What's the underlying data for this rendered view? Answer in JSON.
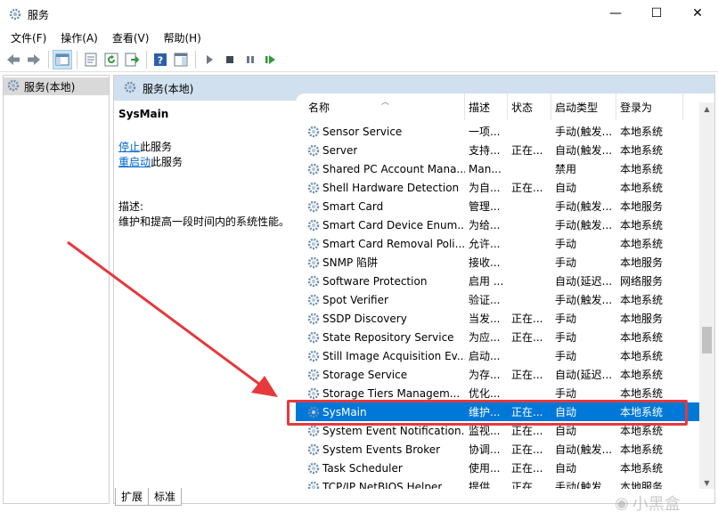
{
  "window": {
    "title": "服务",
    "minimize_glyph": "—",
    "maximize_glyph": "☐",
    "close_glyph": "✕"
  },
  "menu": [
    "文件(F)",
    "操作(A)",
    "查看(V)",
    "帮助(H)"
  ],
  "tree": {
    "root_label": "服务(本地)"
  },
  "panel": {
    "header": "服务(本地)",
    "service_name": "SysMain",
    "stop_link": "停止",
    "stop_suffix": "此服务",
    "restart_link": "重启动",
    "restart_suffix": "此服务",
    "description_label": "描述:",
    "description_text": "维护和提高一段时间内的系统性能。"
  },
  "table": {
    "columns": [
      "名称",
      "描述",
      "状态",
      "启动类型",
      "登录为"
    ],
    "rows": [
      [
        "Sensor Service",
        "一项...",
        "",
        "手动(触发...",
        "本地系统"
      ],
      [
        "Server",
        "支持...",
        "正在...",
        "自动(触发...",
        "本地系统"
      ],
      [
        "Shared PC Account Mana...",
        "Man...",
        "",
        "禁用",
        "本地系统"
      ],
      [
        "Shell Hardware Detection",
        "为自...",
        "正在...",
        "自动",
        "本地系统"
      ],
      [
        "Smart Card",
        "管理...",
        "",
        "手动(触发...",
        "本地服务"
      ],
      [
        "Smart Card Device Enum...",
        "为给...",
        "",
        "手动(触发...",
        "本地系统"
      ],
      [
        "Smart Card Removal Poli...",
        "允许...",
        "",
        "手动",
        "本地系统"
      ],
      [
        "SNMP 陷阱",
        "接收...",
        "",
        "手动",
        "本地服务"
      ],
      [
        "Software Protection",
        "启用 ...",
        "",
        "自动(延迟...",
        "网络服务"
      ],
      [
        "Spot Verifier",
        "验证...",
        "",
        "手动(触发...",
        "本地系统"
      ],
      [
        "SSDP Discovery",
        "当发...",
        "正在...",
        "手动",
        "本地服务"
      ],
      [
        "State Repository Service",
        "为应...",
        "正在...",
        "手动",
        "本地系统"
      ],
      [
        "Still Image Acquisition Ev...",
        "启动...",
        "",
        "手动",
        "本地系统"
      ],
      [
        "Storage Service",
        "为存...",
        "正在...",
        "自动(延迟...",
        "本地系统"
      ],
      [
        "Storage Tiers Managem...",
        "优化...",
        "",
        "手动",
        "本地系统"
      ],
      [
        "SysMain",
        "维护...",
        "正在...",
        "自动",
        "本地系统"
      ],
      [
        "System Event Notification...",
        "监视...",
        "正在...",
        "自动",
        "本地系统"
      ],
      [
        "System Events Broker",
        "协调...",
        "正在...",
        "自动(触发...",
        "本地系统"
      ],
      [
        "Task Scheduler",
        "使用...",
        "正在...",
        "自动",
        "本地系统"
      ],
      [
        "TCP/IP NetBIOS Helper",
        "提供...",
        "正在...",
        "手动(触发...",
        "本地服务"
      ]
    ],
    "selected_index": 15
  },
  "tabs": [
    "扩展",
    "标准"
  ],
  "watermark": "小黑盒",
  "colors": {
    "selection": "#0078d7",
    "highlight": "#e5393d",
    "header_bg": "#d0e0ee"
  }
}
